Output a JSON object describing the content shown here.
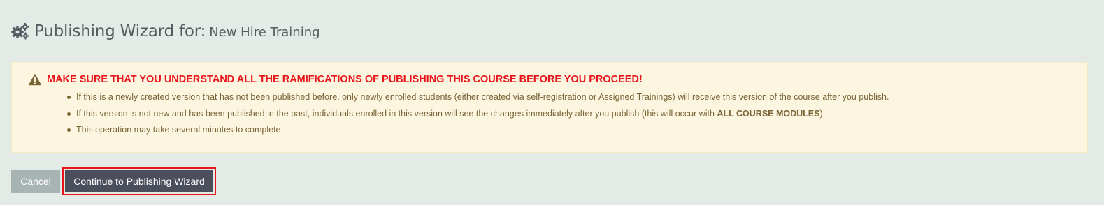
{
  "header": {
    "icon": "gears-icon",
    "title_prefix": "Publishing Wizard for:",
    "course_name": "New Hire Training"
  },
  "alert": {
    "icon": "warning-icon",
    "title": "MAKE SURE THAT YOU UNDERSTAND ALL THE RAMIFICATIONS OF PUBLISHING THIS COURSE BEFORE YOU PROCEED!",
    "items": [
      {
        "text": "If this is a newly created version that has not been published before, only newly enrolled students (either created via self-registration or Assigned Trainings) will receive this version of the course after you publish."
      },
      {
        "text_before": "If this version is not new and has been published in the past, individuals enrolled in this version will see the changes immediately after you publish (this will occur with ",
        "emphasis": "ALL COURSE MODULES",
        "text_after": ")."
      },
      {
        "text": "This operation may take several minutes to complete."
      }
    ]
  },
  "actions": {
    "cancel_label": "Cancel",
    "continue_label": "Continue to Publishing Wizard"
  },
  "colors": {
    "page_background": "#e4eae6",
    "alert_background": "#fcf6e1",
    "alert_title": "#e8141c",
    "alert_text": "#7a6436",
    "cancel_button": "#a8b3b3",
    "continue_button": "#4b4f5c",
    "highlight_border": "#e8141c"
  }
}
